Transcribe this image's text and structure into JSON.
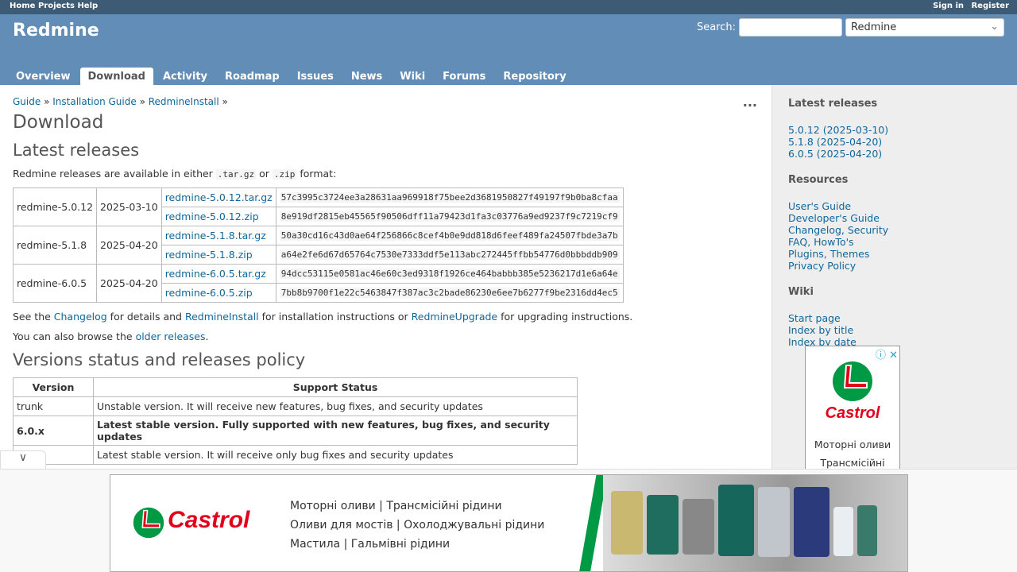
{
  "top_menu": {
    "left": [
      "Home",
      "Projects",
      "Help"
    ],
    "right": [
      "Sign in",
      "Register"
    ]
  },
  "header": {
    "title": "Redmine",
    "search_label": "Search:",
    "search_value": "",
    "project_select": "Redmine"
  },
  "tabs": [
    "Overview",
    "Download",
    "Activity",
    "Roadmap",
    "Issues",
    "News",
    "Wiki",
    "Forums",
    "Repository"
  ],
  "breadcrumb": [
    "Guide",
    "Installation Guide",
    "RedmineInstall"
  ],
  "page": {
    "title": "Download",
    "latest_heading": "Latest releases",
    "intro": [
      "Redmine releases are available in either ",
      ".tar.gz",
      " or ",
      ".zip",
      " format:"
    ],
    "releases": [
      {
        "name": "redmine-5.0.12",
        "date": "2025-03-10",
        "files": [
          {
            "file": "redmine-5.0.12.tar.gz",
            "hash": "57c3995c3724ee3a28631aa969918f75bee2d3681950827f49197f9b0ba8cfaa"
          },
          {
            "file": "redmine-5.0.12.zip",
            "hash": "8e919df2815eb45565f90506dff11a79423d1fa3c03776a9ed9237f9c7219cf9"
          }
        ]
      },
      {
        "name": "redmine-5.1.8",
        "date": "2025-04-20",
        "files": [
          {
            "file": "redmine-5.1.8.tar.gz",
            "hash": "50a30cd16c43d0ae64f256866c8cef4b0e9dd818d6feef489fa24507fbde3a7b"
          },
          {
            "file": "redmine-5.1.8.zip",
            "hash": "a64e2fe6d67d65764c7530e7333ddf5e113abc272445ffbb54776d0bbbddb909"
          }
        ]
      },
      {
        "name": "redmine-6.0.5",
        "date": "2025-04-20",
        "files": [
          {
            "file": "redmine-6.0.5.tar.gz",
            "hash": "94dcc53115e0581ac46e60c3ed9318f1926ce464babbb385e5236217d1e6a64e"
          },
          {
            "file": "redmine-6.0.5.zip",
            "hash": "7bb8b9700f1e22c5463847f387ac3c2bade86230e6ee7b6277f9be2316dd4ec5"
          }
        ]
      }
    ],
    "see_also": [
      "See the ",
      "Changelog",
      " for details and ",
      "RedmineInstall",
      " for installation instructions or ",
      "RedmineUpgrade",
      " for upgrading instructions."
    ],
    "browse": [
      "You can also browse the ",
      "older releases",
      "."
    ],
    "policy_heading": "Versions status and releases policy",
    "policy_headers": [
      "Version",
      "Support Status"
    ],
    "policy_rows": [
      {
        "version": "trunk",
        "status": "Unstable version. It will receive new features, bug fixes, and security updates",
        "bold": false
      },
      {
        "version": "6.0.x",
        "status": "Latest stable version. Fully supported with new features, bug fixes, and security updates",
        "bold": true
      },
      {
        "version": "",
        "status": "Latest stable version. It will receive only bug fixes and security updates",
        "bold": false
      }
    ]
  },
  "sidebar": {
    "latest_heading": "Latest releases",
    "latest": [
      "5.0.12 (2025-03-10)",
      "5.1.8 (2025-04-20)",
      "6.0.5 (2025-04-20)"
    ],
    "resources_heading": "Resources",
    "resources": [
      "User's Guide",
      "Developer's Guide",
      "Changelog, Security",
      "FAQ, HowTo's",
      "Plugins, Themes",
      "Privacy Policy"
    ],
    "wiki_heading": "Wiki",
    "wiki": [
      "Start page",
      "Index by title",
      "Index by date"
    ]
  },
  "side_ad": {
    "brand": "Castrol",
    "lines": [
      "Моторні оливи",
      "Трансмісійні"
    ]
  },
  "bottom_ad": {
    "brand": "Castrol",
    "lines": [
      "Моторні оливи | Трансмісійні рідини",
      "Оливи для мостів | Охолоджувальні рідини",
      "Мастила | Гальмівні рідини"
    ]
  },
  "colors": {
    "top_menu": "#3e5b76",
    "header": "#628db6",
    "link": "#116699",
    "sidebar": "#eeeeee",
    "castrol_red": "#e2001a",
    "castrol_green": "#009a44"
  }
}
